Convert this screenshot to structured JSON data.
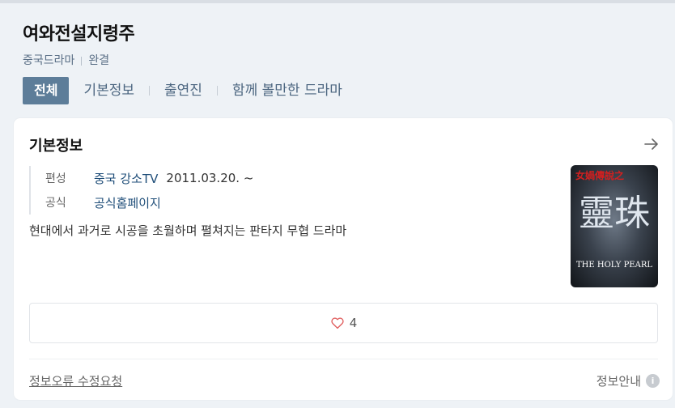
{
  "header": {
    "title": "여와전설지령주",
    "genre": "중국드라마",
    "status": "완결"
  },
  "tabs": [
    {
      "label": "전체",
      "active": true
    },
    {
      "label": "기본정보",
      "active": false
    },
    {
      "label": "출연진",
      "active": false
    },
    {
      "label": "함께 볼만한 드라마",
      "active": false
    }
  ],
  "basic_info": {
    "title": "기본정보",
    "rows": [
      {
        "label": "편성",
        "value": "중국 강소TV",
        "extra": "2011.03.20. ~"
      },
      {
        "label": "공식",
        "value": "공식홈페이지"
      }
    ],
    "description": "현대에서 과거로 시공을 초월하며 펼쳐지는 판타지 무협 드라마",
    "poster": {
      "top_text": "女媧傳說之",
      "center_text": "靈珠",
      "bottom_text": "THE HOLY PEARL"
    },
    "likes": "4",
    "report_label": "정보오류 수정요청",
    "guide_label": "정보안내"
  },
  "colors": {
    "accent": "#5d7d99",
    "link": "#1f4e79",
    "heart": "#e05c5c"
  }
}
